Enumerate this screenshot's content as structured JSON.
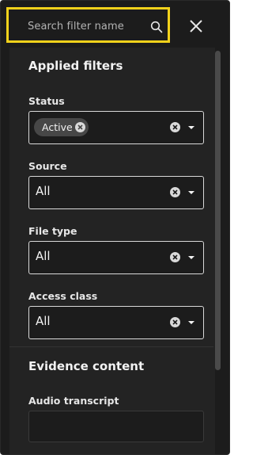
{
  "search": {
    "placeholder": "Search filter name",
    "icon": "search-icon"
  },
  "close": {
    "icon": "close-icon"
  },
  "applied_filters": {
    "title": "Applied filters",
    "fields": [
      {
        "label": "Status",
        "chip": "Active"
      },
      {
        "label": "Source",
        "value": "All"
      },
      {
        "label": "File type",
        "value": "All"
      },
      {
        "label": "Access class",
        "value": "All"
      }
    ]
  },
  "evidence_content": {
    "title": "Evidence content",
    "fields": [
      {
        "label": "Audio transcript",
        "value": ""
      }
    ]
  },
  "colors": {
    "highlight": "#f3d21b",
    "background": "#1c1c1c",
    "panel": "#232323",
    "chip": "#474747"
  }
}
